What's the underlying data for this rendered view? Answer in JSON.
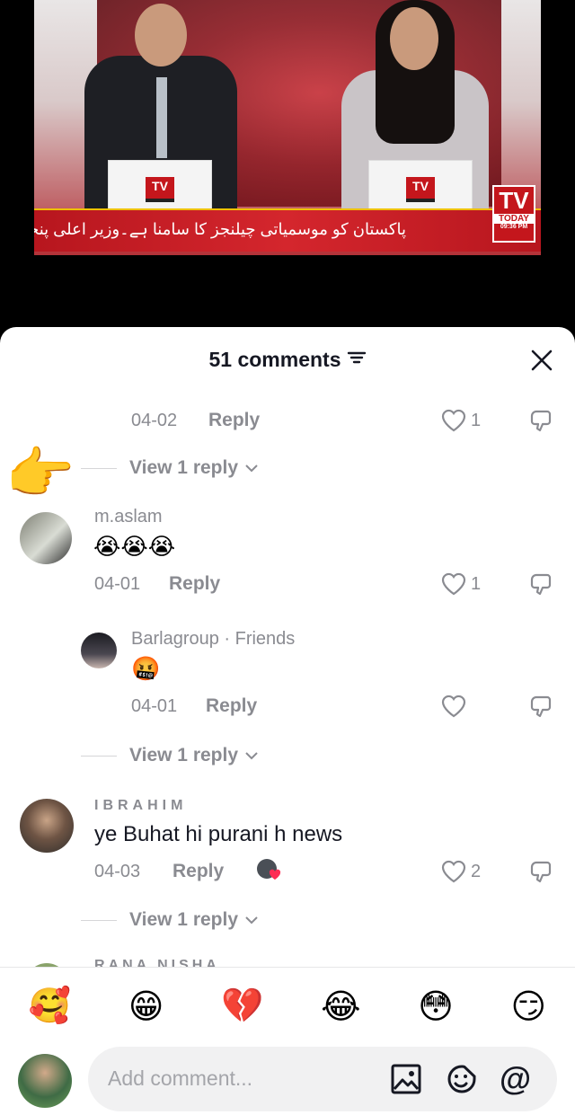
{
  "video": {
    "ticker_text": "پاکستان کو موسمیاتی چیلنجز کا سامنا ہے۔وزیر اعلی پنجاب مریم نواز",
    "desk_logo": "TV",
    "channel_logo": {
      "big": "TV",
      "small": "TODAY",
      "time": "09:36 PM"
    }
  },
  "header": {
    "title": "51 comments"
  },
  "comments_top": {
    "date": "04-02",
    "reply_label": "Reply",
    "likes": "1",
    "view_replies": "View 1 reply"
  },
  "comments": [
    {
      "username": "m.aslam",
      "text": "😭😭😭",
      "date": "04-01",
      "reply_label": "Reply",
      "likes": "1"
    },
    {
      "username": "Barlagroup · Friends",
      "text": "🤬",
      "date": "04-01",
      "reply_label": "Reply",
      "likes": "",
      "view_replies": "View 1 reply"
    },
    {
      "username": "IBRAHIM",
      "text": "ye Buhat hi purani h news",
      "date": "04-03",
      "reply_label": "Reply",
      "likes": "2",
      "view_replies": "View 1 reply"
    },
    {
      "username": "RANA NISHA"
    }
  ],
  "pointer_emoji": "👉",
  "quick_emojis": [
    "🥰",
    "😁",
    "💔",
    "😂",
    "😳",
    "😏"
  ],
  "composer": {
    "placeholder": "Add comment...",
    "mention": "@"
  },
  "colors": {
    "muted": "#8a8b91",
    "text": "#161823",
    "accent_red": "#c4161c"
  }
}
